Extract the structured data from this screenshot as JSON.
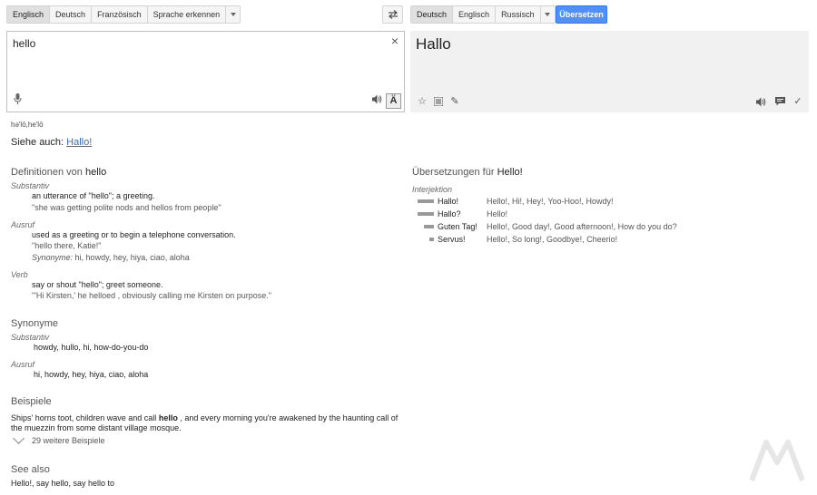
{
  "source_langs": [
    "Englisch",
    "Deutsch",
    "Französisch",
    "Sprache erkennen"
  ],
  "target_langs": [
    "Deutsch",
    "Englisch",
    "Russisch"
  ],
  "translate_button": "Übersetzen",
  "source_text": "hello",
  "target_text": "Hallo",
  "keyboard_label": "Ä",
  "phonetic": "hə'lō,he'lō",
  "see_also_top": {
    "label": "Siehe auch:",
    "link": "Hallo!"
  },
  "definitions": {
    "title_prefix": "Definitionen von",
    "title_word": "hello",
    "entries": [
      {
        "pos": "Substantiv",
        "def": "an utterance of \"hello\"; a greeting.",
        "example": "\"she was getting polite nods and hellos from people\""
      },
      {
        "pos": "Ausruf",
        "def": "used as a greeting or to begin a telephone conversation.",
        "example": "\"hello there, Katie!\"",
        "syn_label": "Synonyme:",
        "syn": "hi, howdy, hey, hiya, ciao, aloha"
      },
      {
        "pos": "Verb",
        "def": "say or shout \"hello\"; greet someone.",
        "example": "\"'Hi Kirsten,' he helloed , obviously calling me Kirsten on purpose.\""
      }
    ]
  },
  "synonyms": {
    "title": "Synonyme",
    "groups": [
      {
        "pos": "Substantiv",
        "words": "howdy, hullo, hi, how-do-you-do"
      },
      {
        "pos": "Ausruf",
        "words": "hi, howdy, hey, hiya, ciao, aloha"
      }
    ]
  },
  "examples": {
    "title": "Beispiele",
    "text_before": "Ships' horns toot, children wave and call",
    "text_bold": "hello",
    "text_after": ", and every morning you're awakened by the haunting call of the muezzin from some distant village mosque.",
    "more": "29 weitere Beispiele"
  },
  "see_also_bottom": {
    "title": "See also",
    "text": "Hello!, say hello, say hello to"
  },
  "translations": {
    "title_prefix": "Übersetzungen für",
    "title_word": "Hello!",
    "pos": "Interjektion",
    "rows": [
      {
        "word": "Hallo!",
        "reverse": "Hello!, Hi!, Hey!, Yoo-Hoo!, Howdy!",
        "frequency": 1.0
      },
      {
        "word": "Hallo?",
        "reverse": "Hello!",
        "frequency": 1.0
      },
      {
        "word": "Guten Tag!",
        "reverse": "Hello!, Good day!, Good afternoon!, How do you do?",
        "frequency": 0.6
      },
      {
        "word": "Servus!",
        "reverse": "Hello!, So long!, Goodbye!, Cheerio!",
        "frequency": 0.3
      }
    ]
  }
}
